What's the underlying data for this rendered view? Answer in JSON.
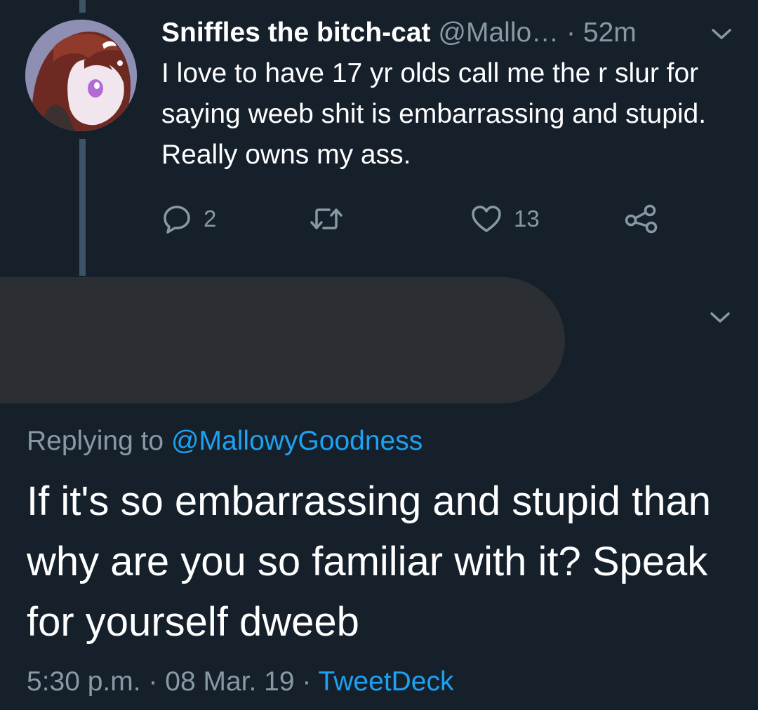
{
  "tweet": {
    "display_name": "Sniffles the bitch-cat",
    "handle": "@Mallo…",
    "separator": "·",
    "time": "52m",
    "text": "I love to have 17 yr olds call me the r slur for saying weeb shit is embarrassing and stupid. Really owns my ass.",
    "actions": {
      "reply_count": "2",
      "retweet_count": "",
      "like_count": "13"
    }
  },
  "reply": {
    "replying_prefix": "Replying to",
    "replying_to": "@MallowyGoodness",
    "text": "If it's so embarrassing and stupid than why are you so familiar with it? Speak for yourself dweeb",
    "footer": {
      "time": "5:30 p.m.",
      "separator": "·",
      "date": "08 Mar. 19",
      "source": "TweetDeck"
    }
  },
  "icons": {
    "reply": "reply-icon",
    "retweet": "retweet-icon",
    "like": "heart-icon",
    "share": "share-icon",
    "more": "chevron-down-icon"
  },
  "colors": {
    "background": "#15202b",
    "secondary_text": "#8899a6",
    "link": "#1da1f2",
    "thread_line": "#3d5466",
    "redaction": "#2b2f33"
  }
}
